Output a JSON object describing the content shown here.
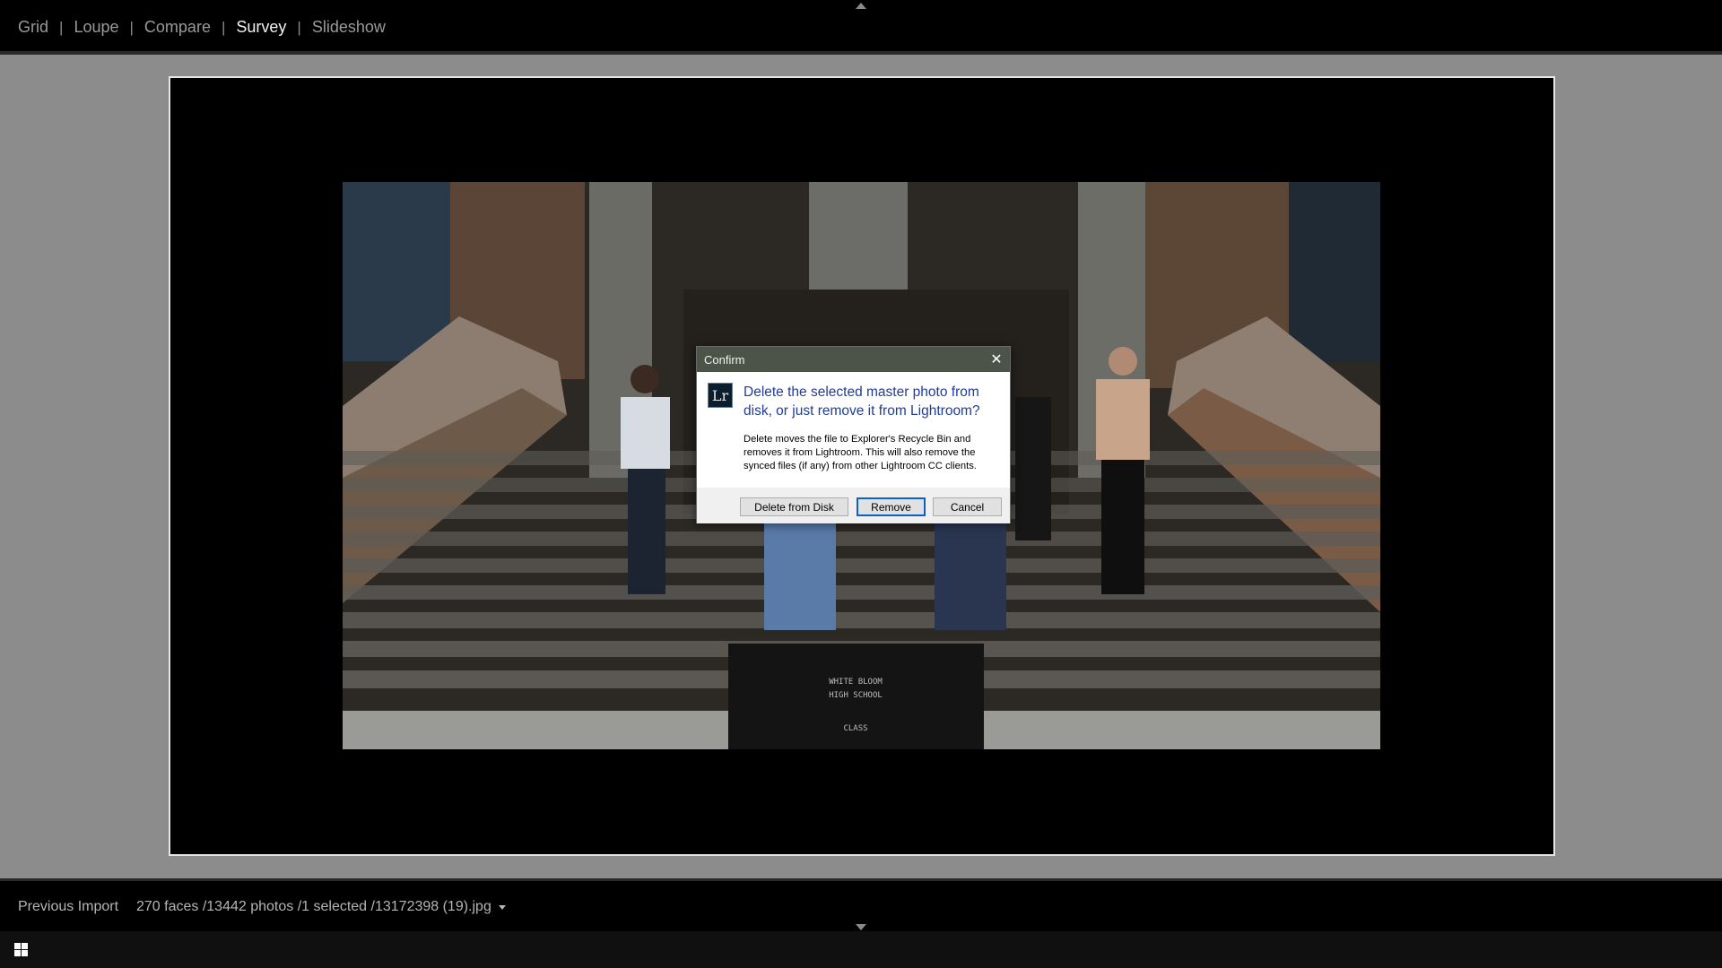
{
  "header": {
    "modules": [
      "Grid",
      "Loupe",
      "Compare",
      "Survey",
      "Slideshow"
    ],
    "active_module": "Survey",
    "separator": "|"
  },
  "survey": {
    "photo_label": "WHITE BLOOM HIGH SCHOOL CLASS"
  },
  "dialog": {
    "title": "Confirm",
    "icon_text": "Lr",
    "heading": "Delete the selected master photo from disk, or just remove it from Lightroom?",
    "body": "Delete moves the file to Explorer's Recycle Bin and removes it from Lightroom.  This will also remove the synced files (if any) from other Lightroom CC clients.",
    "buttons": {
      "delete": "Delete from Disk",
      "remove": "Remove",
      "cancel": "Cancel"
    },
    "default_button": "Remove"
  },
  "filmstrip": {
    "source": "Previous Import",
    "info": "270 faces /13442 photos /1 selected /13172398 (19).jpg"
  },
  "icons": [
    "collapse-top-icon",
    "close-icon",
    "lightroom-icon",
    "dropdown-caret-icon",
    "collapse-bottom-icon",
    "windows-logo-icon"
  ],
  "colors": {
    "dialog_heading": "#1f3d99",
    "dialog_titlebar": "#4c5449",
    "default_button_border": "#0a62c8",
    "survey_background": "#8c8c8c"
  }
}
